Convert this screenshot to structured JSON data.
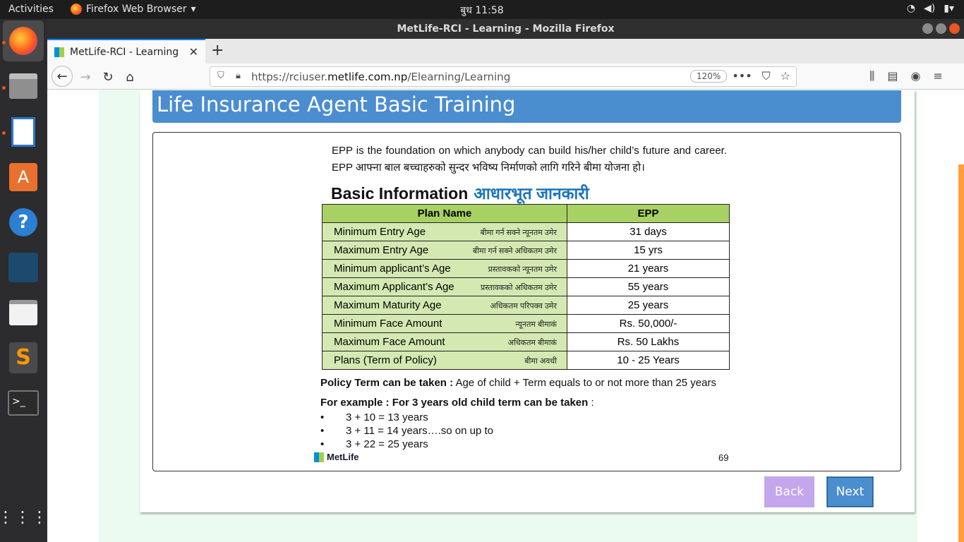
{
  "topbar": {
    "activities": "Activities",
    "app_name": "Firefox Web Browser",
    "clock": "बुध 11:58"
  },
  "window": {
    "title": "MetLife-RCI - Learning - Mozilla Firefox"
  },
  "tab": {
    "label": "MetLife-RCI - Learning"
  },
  "urlbar": {
    "url_prefix": "https://rciuser.",
    "url_domain": "metlife.com.np",
    "url_path": "/Elearning/Learning",
    "zoom": "120%"
  },
  "page": {
    "banner_title": "Life Insurance Agent Basic Training",
    "intro": "EPP is the foundation on which anybody can build his/her child’s future and career. EPP आफ्ना बाल बच्चाहरुको सुन्दर भविष्य निर्माणको लागि गरिने बीमा योजना हो।",
    "heading_en": "Basic Information",
    "heading_np": "आधारभूत जानकारी",
    "table": {
      "col1": "Plan Name",
      "col2": "EPP",
      "rows": [
        {
          "label": "Minimum Entry Age",
          "np": "बीमा गर्न सक्ने न्यूनतम उमेर",
          "value": "31 days"
        },
        {
          "label": "Maximum Entry Age",
          "np": "बीमा गर्न सक्ने अधिकतम उमेर",
          "value": "15 yrs"
        },
        {
          "label": "Minimum applicant’s Age",
          "np": "प्रस्तावकको न्यूनतम उमेर",
          "value": "21 years"
        },
        {
          "label": "Maximum Applicant’s Age",
          "np": "प्रस्तावकको अधिकतम उमेर",
          "value": "55 years"
        },
        {
          "label": "Maximum Maturity Age",
          "np": "अधिकतम परिपक्व उमेर",
          "value": "25  years"
        },
        {
          "label": "Minimum Face Amount",
          "np": "न्यूनतम बीमाकं",
          "value": "Rs. 50,000/-"
        },
        {
          "label": "Maximum Face Amount",
          "np": "अधिकतम बीमाकं",
          "value": "Rs. 50 Lakhs"
        },
        {
          "label": "Plans (Term of Policy)",
          "np": "बीमा अवधी",
          "value": "10 - 25  Years"
        }
      ]
    },
    "policy_bold": "Policy Term can be taken :",
    "policy_text": " Age of child + Term  equals to or not more than 25 years",
    "example_bold": "For example :  For 3 years old child term can be  taken",
    "example_colon": " :",
    "bullets": [
      "3 + 10 =  13 years",
      "3 + 11 = 14 years….so on up to",
      "3 + 22 = 25 years"
    ],
    "bullet_char": "•",
    "logo_text": "MetLife",
    "page_number": "69",
    "back_label": "Back",
    "next_label": "Next"
  }
}
